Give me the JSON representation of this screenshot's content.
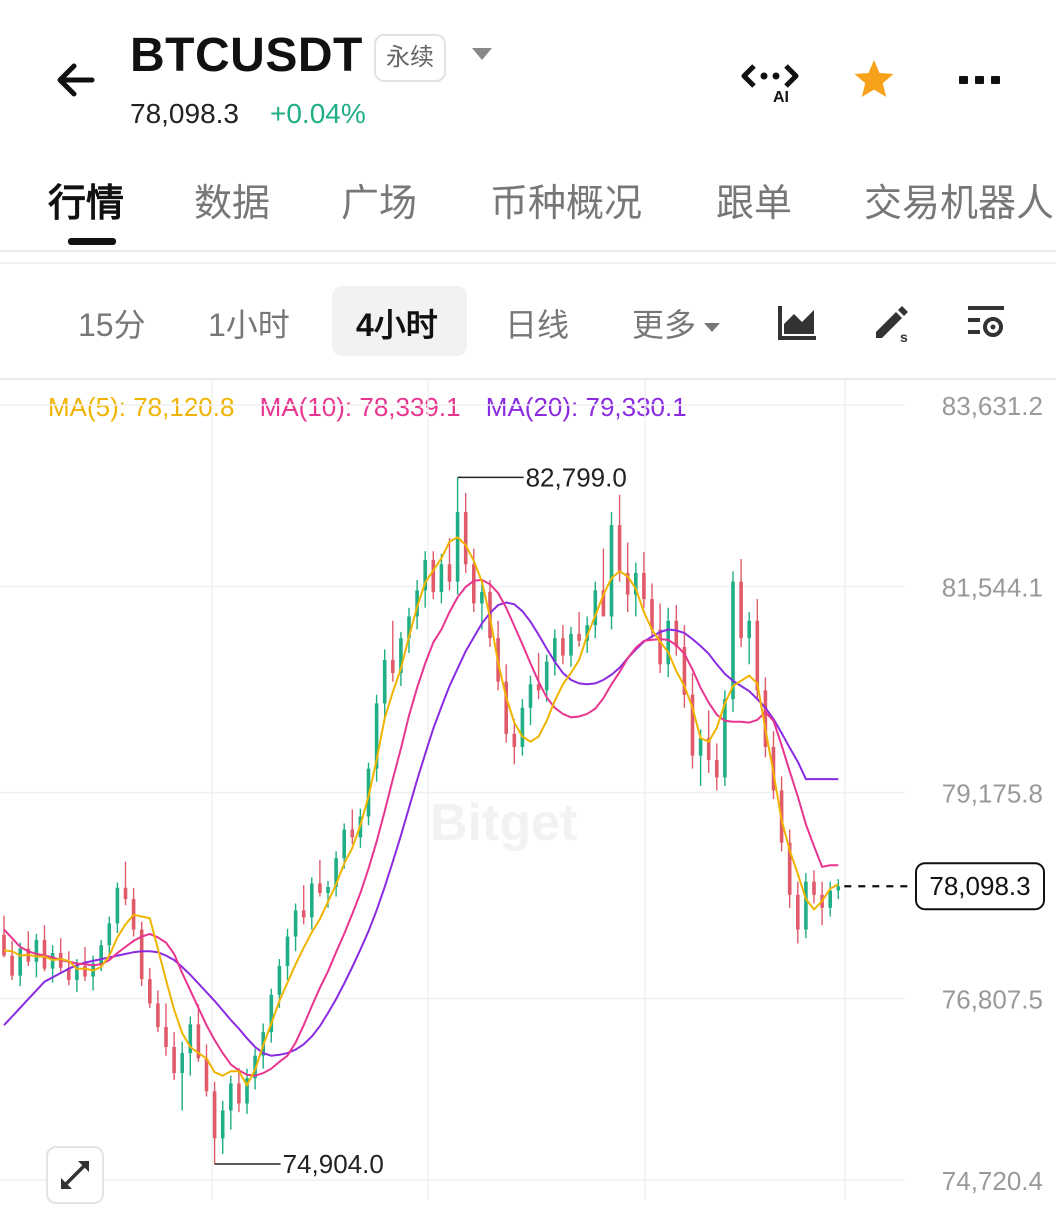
{
  "header": {
    "symbol": "BTCUSDT",
    "contract_type": "永续",
    "last_price": "78,098.3",
    "change_pct": "+0.04%",
    "ai_label": "AI",
    "icons": [
      "back-arrow-icon",
      "ai-assistant-icon",
      "star-icon",
      "more-icon"
    ],
    "star_color": "#f7a21b",
    "up_color": "#1fae86"
  },
  "tabs": {
    "items": [
      "行情",
      "数据",
      "广场",
      "币种概况",
      "跟单",
      "交易机器人"
    ],
    "active": "行情"
  },
  "timeframes": {
    "items": [
      "15分",
      "1小时",
      "4小时",
      "日线",
      "更多"
    ],
    "active": "4小时",
    "tool_icons": [
      "indicator-chart-icon",
      "draw-pen-icon",
      "chart-settings-icon"
    ]
  },
  "ma_legend": {
    "ma5": "MA(5): 78,120.8",
    "ma10": "MA(10): 78,339.1",
    "ma20": "MA(20): 79,330.1",
    "ma5_color": "#f0b400",
    "ma10_color": "#e8358f",
    "ma20_color": "#8a2be2"
  },
  "watermark": "Bitget",
  "chart_data": {
    "type": "candlestick",
    "interval": "4小时",
    "y_ticks": [
      "83,631.2",
      "81,544.1",
      "79,175.8",
      "76,807.5",
      "74,720.4"
    ],
    "y_tick_values": [
      83631.2,
      81544.1,
      79175.8,
      76807.5,
      74720.4
    ],
    "ylim": [
      74720.4,
      83631.2
    ],
    "high_label": "82,799.0",
    "high_value": 82799.0,
    "low_label": "74,904.0",
    "low_value": 74904.0,
    "current_price_label": "78,098.3",
    "current_price": 78098.3,
    "up_color": "#1fae86",
    "down_color": "#e05a6a",
    "candles": [
      [
        77540,
        77760,
        77280,
        77300
      ],
      [
        77300,
        77470,
        77020,
        77070
      ],
      [
        77070,
        77450,
        76950,
        77380
      ],
      [
        77380,
        77580,
        77180,
        77230
      ],
      [
        77230,
        77550,
        77050,
        77480
      ],
      [
        77480,
        77650,
        77120,
        77150
      ],
      [
        77150,
        77420,
        76990,
        77330
      ],
      [
        77330,
        77500,
        77110,
        77160
      ],
      [
        77160,
        77350,
        76960,
        77020
      ],
      [
        77020,
        77260,
        76880,
        77180
      ],
      [
        77180,
        77400,
        77010,
        77060
      ],
      [
        77060,
        77300,
        76900,
        77210
      ],
      [
        77210,
        77480,
        77120,
        77420
      ],
      [
        77420,
        77750,
        77300,
        77670
      ],
      [
        77670,
        78140,
        77560,
        78080
      ],
      [
        78080,
        78380,
        77880,
        77950
      ],
      [
        77950,
        78080,
        77520,
        77600
      ],
      [
        77600,
        77690,
        76950,
        77030
      ],
      [
        77030,
        77160,
        76700,
        76750
      ],
      [
        76750,
        76900,
        76420,
        76480
      ],
      [
        76480,
        76750,
        76150,
        76250
      ],
      [
        76250,
        76420,
        75870,
        75950
      ],
      [
        75950,
        76310,
        75520,
        76180
      ],
      [
        76180,
        76600,
        75920,
        76510
      ],
      [
        76510,
        76740,
        76080,
        76120
      ],
      [
        76120,
        76280,
        75680,
        75740
      ],
      [
        75740,
        75850,
        74904,
        75200
      ],
      [
        75200,
        75630,
        75020,
        75520
      ],
      [
        75520,
        75920,
        75300,
        75830
      ],
      [
        75830,
        76010,
        75500,
        75600
      ],
      [
        75600,
        76000,
        75480,
        75890
      ],
      [
        75890,
        76230,
        75760,
        76150
      ],
      [
        76150,
        76520,
        76000,
        76420
      ],
      [
        76420,
        76920,
        76300,
        76850
      ],
      [
        76850,
        77260,
        76700,
        77180
      ],
      [
        77180,
        77610,
        77020,
        77520
      ],
      [
        77520,
        77900,
        77350,
        77820
      ],
      [
        77820,
        78110,
        77660,
        77740
      ],
      [
        77740,
        78200,
        77600,
        78130
      ],
      [
        78130,
        78400,
        77980,
        78020
      ],
      [
        78020,
        78160,
        77850,
        78090
      ],
      [
        78090,
        78500,
        77980,
        78420
      ],
      [
        78420,
        78820,
        78300,
        78750
      ],
      [
        78750,
        78980,
        78580,
        78660
      ],
      [
        78660,
        78990,
        78540,
        78900
      ],
      [
        78900,
        79520,
        78800,
        79450
      ],
      [
        79450,
        80300,
        79300,
        80200
      ],
      [
        80200,
        80820,
        80000,
        80700
      ],
      [
        80700,
        81150,
        80450,
        80550
      ],
      [
        80550,
        81020,
        80400,
        80950
      ],
      [
        80950,
        81300,
        80780,
        81200
      ],
      [
        81200,
        81620,
        81050,
        81500
      ],
      [
        81500,
        81950,
        81300,
        81850
      ],
      [
        81850,
        81950,
        81400,
        81480
      ],
      [
        81480,
        81920,
        81350,
        81800
      ],
      [
        81800,
        82100,
        81500,
        81600
      ],
      [
        81600,
        82799,
        81450,
        82400
      ],
      [
        82400,
        82620,
        81700,
        81800
      ],
      [
        81800,
        81980,
        81250,
        81350
      ],
      [
        81350,
        81600,
        81050,
        81480
      ],
      [
        81480,
        81620,
        80850,
        80950
      ],
      [
        80950,
        81150,
        80350,
        80450
      ],
      [
        80450,
        80650,
        79750,
        79850
      ],
      [
        79850,
        80020,
        79500,
        79700
      ],
      [
        79700,
        80250,
        79600,
        80150
      ],
      [
        80150,
        80520,
        79950,
        80420
      ],
      [
        80420,
        80780,
        80250,
        80350
      ],
      [
        80350,
        80760,
        80220,
        80680
      ],
      [
        80680,
        81050,
        80520,
        80950
      ],
      [
        80950,
        81100,
        80650,
        80750
      ],
      [
        80750,
        81080,
        80620,
        81000
      ],
      [
        81000,
        81250,
        80850,
        80920
      ],
      [
        80920,
        81200,
        80780,
        81100
      ],
      [
        81100,
        81600,
        80950,
        81500
      ],
      [
        81500,
        81980,
        81250,
        81200
      ],
      [
        81200,
        82400,
        81050,
        82250
      ],
      [
        82250,
        82600,
        81600,
        81700
      ],
      [
        81700,
        82050,
        81250,
        81450
      ],
      [
        81450,
        81820,
        81200,
        81700
      ],
      [
        81700,
        81940,
        81300,
        81400
      ],
      [
        81400,
        81580,
        80950,
        81050
      ],
      [
        81050,
        81350,
        80550,
        80650
      ],
      [
        80650,
        81300,
        80500,
        81150
      ],
      [
        81150,
        81330,
        80750,
        80850
      ],
      [
        80850,
        81100,
        80150,
        80300
      ],
      [
        80300,
        80550,
        79450,
        79600
      ],
      [
        79600,
        79900,
        79250,
        79800
      ],
      [
        79800,
        80120,
        79400,
        79550
      ],
      [
        79550,
        79740,
        79200,
        79350
      ],
      [
        79350,
        80350,
        79250,
        80250
      ],
      [
        80250,
        81720,
        80100,
        81600
      ],
      [
        81600,
        81860,
        80850,
        80950
      ],
      [
        80950,
        81250,
        80650,
        81150
      ],
      [
        81150,
        81400,
        80250,
        80350
      ],
      [
        80350,
        80500,
        79580,
        79700
      ],
      [
        79700,
        79880,
        79100,
        79200
      ],
      [
        79200,
        79360,
        78500,
        78600
      ],
      [
        78600,
        78750,
        77850,
        78000
      ],
      [
        78000,
        78150,
        77440,
        77600
      ],
      [
        77600,
        78250,
        77500,
        78150
      ],
      [
        78150,
        78280,
        77900,
        78000
      ],
      [
        78000,
        78150,
        77650,
        77850
      ],
      [
        77850,
        78150,
        77750,
        78050
      ],
      [
        78050,
        78180,
        77950,
        78098.3
      ]
    ],
    "ma5": [
      77360,
      77350,
      77300,
      77310,
      77290,
      77290,
      77250,
      77260,
      77240,
      77150,
      77150,
      77130,
      77170,
      77300,
      77510,
      77660,
      77770,
      77750,
      77730,
      77380,
      77020,
      76680,
      76410,
      76250,
      76180,
      76120,
      75960,
      75920,
      75970,
      75970,
      75810,
      75990,
      76270,
      76520,
      76780,
      76990,
      77200,
      77390,
      77570,
      77720,
      77920,
      78120,
      78360,
      78540,
      78800,
      79130,
      79550,
      80030,
      80330,
      80600,
      80970,
      81310,
      81590,
      81730,
      81870,
      82060,
      82110,
      82020,
      81840,
      81600,
      81190,
      80670,
      80270,
      79980,
      79820,
      79760,
      79820,
      80000,
      80230,
      80420,
      80550,
      80700,
      80980,
      81210,
      81450,
      81640,
      81720,
      81660,
      81520,
      81250,
      81050,
      80910,
      80790,
      80570,
      80400,
      80150,
      79800,
      79760,
      79920,
      80200,
      80400,
      80460,
      80520,
      80430,
      79900,
      79400,
      78860,
      78510,
      78240,
      77950,
      77830,
      77930,
      78070,
      78120.8
    ],
    "ma10": [
      77600,
      77500,
      77400,
      77350,
      77320,
      77300,
      77280,
      77250,
      77230,
      77210,
      77200,
      77190,
      77200,
      77250,
      77330,
      77400,
      77470,
      77520,
      77550,
      77510,
      77450,
      77320,
      77100,
      76900,
      76700,
      76500,
      76330,
      76180,
      76050,
      75980,
      75930,
      75920,
      75950,
      76000,
      76080,
      76150,
      76300,
      76500,
      76720,
      76930,
      77120,
      77340,
      77550,
      77780,
      78020,
      78300,
      78610,
      78960,
      79330,
      79680,
      80060,
      80380,
      80660,
      80900,
      81050,
      81250,
      81420,
      81540,
      81610,
      81620,
      81570,
      81470,
      81300,
      81090,
      80880,
      80660,
      80450,
      80270,
      80150,
      80080,
      80040,
      80050,
      80080,
      80140,
      80260,
      80420,
      80560,
      80720,
      80840,
      80920,
      80930,
      80940,
      80930,
      80870,
      80770,
      80590,
      80380,
      80210,
      80070,
      80000,
      79990,
      79990,
      79980,
      80010,
      80100,
      80000,
      79720,
      79420,
      79130,
      78810,
      78560,
      78320,
      78339.1,
      78339.1
    ],
    "ma20": [
      76500,
      76600,
      76700,
      76800,
      76900,
      77000,
      77050,
      77100,
      77150,
      77190,
      77220,
      77240,
      77260,
      77280,
      77300,
      77320,
      77340,
      77350,
      77350,
      77340,
      77300,
      77250,
      77170,
      77080,
      76980,
      76880,
      76780,
      76670,
      76560,
      76460,
      76350,
      76250,
      76180,
      76150,
      76160,
      76180,
      76220,
      76280,
      76370,
      76490,
      76640,
      76800,
      76980,
      77170,
      77370,
      77580,
      77820,
      78090,
      78380,
      78680,
      79000,
      79320,
      79620,
      79910,
      80160,
      80400,
      80600,
      80800,
      80960,
      81120,
      81240,
      81330,
      81360,
      81340,
      81260,
      81140,
      80990,
      80830,
      80680,
      80550,
      80470,
      80430,
      80420,
      80430,
      80470,
      80530,
      80610,
      80720,
      80820,
      80910,
      80970,
      81020,
      81050,
      81040,
      81010,
      80940,
      80860,
      80770,
      80650,
      80540,
      80460,
      80400,
      80340,
      80250,
      80150,
      80020,
      79860,
      79690,
      79530,
      79330.1,
      79330.1,
      79330.1,
      79330.1,
      79330.1
    ],
    "grid": true,
    "price_scale_side": "right"
  }
}
